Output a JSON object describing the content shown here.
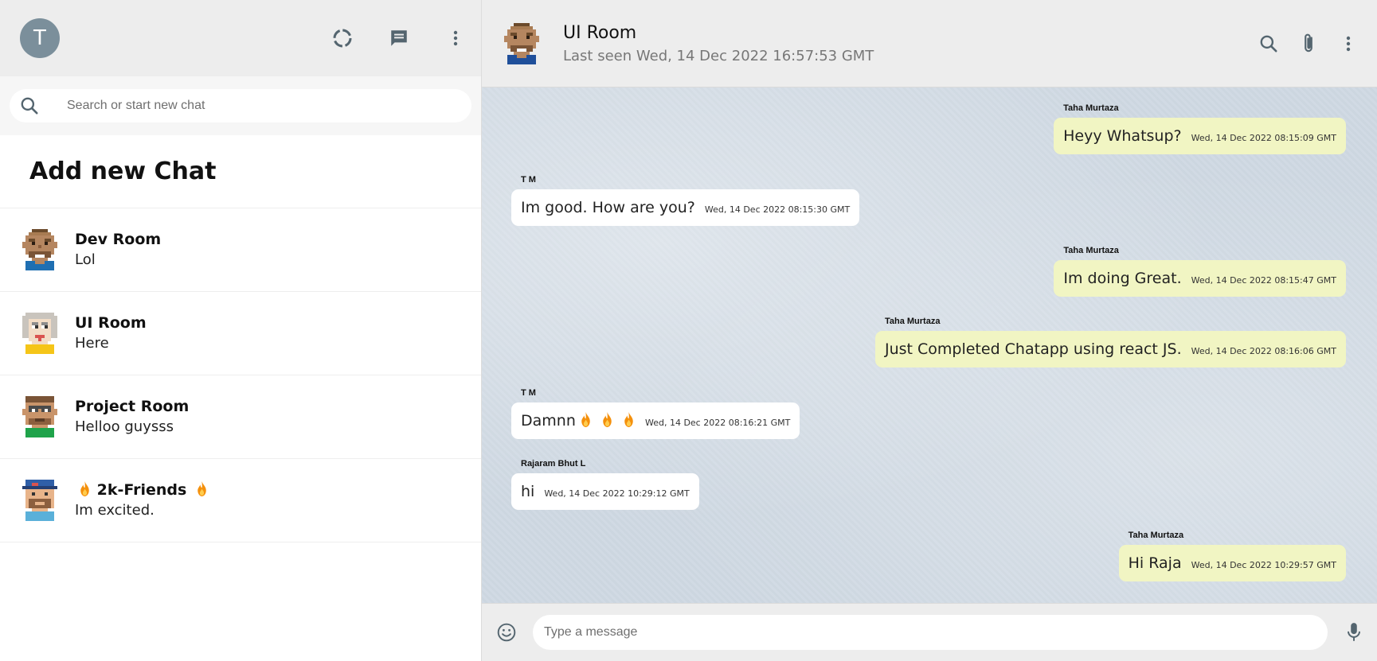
{
  "sidebar": {
    "user_avatar_letter": "T",
    "search": {
      "placeholder": "Search or start new chat"
    },
    "add_chat_label": "Add new Chat",
    "chats": [
      {
        "name": "Dev Room",
        "last_message": "Lol",
        "avatar_icon": "pixel-avatar-brown-icon"
      },
      {
        "name": "UI Room",
        "last_message": "Here",
        "avatar_icon": "pixel-avatar-grey-hair-icon"
      },
      {
        "name": "Project Room",
        "last_message": "Helloo guysss",
        "avatar_icon": "pixel-avatar-glasses-icon"
      },
      {
        "name": "2k-Friends",
        "last_message": "Im excited.",
        "avatar_icon": "pixel-avatar-cap-icon",
        "emoji": "🔥"
      }
    ]
  },
  "chat_header": {
    "room_name": "UI Room",
    "last_seen": "Last seen Wed, 14 Dec 2022 16:57:53 GMT"
  },
  "messages": [
    {
      "sender": "Taha Murtaza",
      "text": "Heyy Whatsup?",
      "time": "Wed, 14 Dec 2022 08:15:09 GMT",
      "direction": "outgoing"
    },
    {
      "sender": "T M",
      "text": "Im good. How are you?",
      "time": "Wed, 14 Dec 2022 08:15:30 GMT",
      "direction": "incoming"
    },
    {
      "sender": "Taha Murtaza",
      "text": "Im doing Great.",
      "time": "Wed, 14 Dec 2022 08:15:47 GMT",
      "direction": "outgoing"
    },
    {
      "sender": "Taha Murtaza",
      "text": "Just Completed Chatapp using react JS.",
      "time": "Wed, 14 Dec 2022 08:16:06 GMT",
      "direction": "outgoing"
    },
    {
      "sender": "T M",
      "text": "Damnn",
      "emojis": "🔥 🔥 🔥",
      "time": "Wed, 14 Dec 2022 08:16:21 GMT",
      "direction": "incoming"
    },
    {
      "sender": "Rajaram Bhut L",
      "text": "hi",
      "time": "Wed, 14 Dec 2022 10:29:12 GMT",
      "direction": "incoming"
    },
    {
      "sender": "Taha Murtaza",
      "text": "Hi Raja",
      "time": "Wed, 14 Dec 2022 10:29:57 GMT",
      "direction": "outgoing"
    }
  ],
  "footer": {
    "placeholder": "Type a message"
  },
  "colors": {
    "outgoing_bubble": "#f1f5c3",
    "incoming_bubble": "#ffffff",
    "header_bg": "#ededed",
    "avatar_bg": "#7b8f9b"
  }
}
